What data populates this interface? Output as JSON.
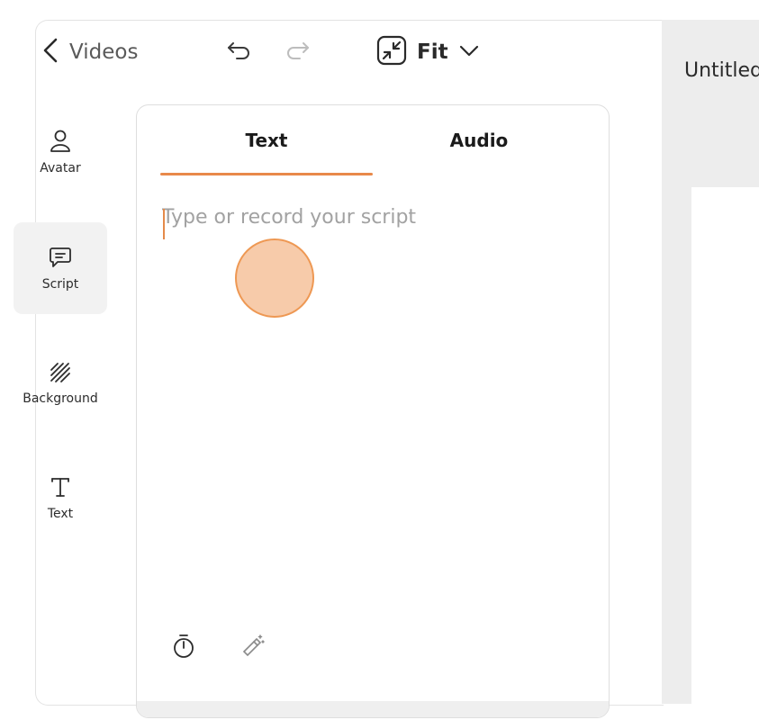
{
  "topbar": {
    "back_label": "Videos",
    "zoom_label": "Fit"
  },
  "canvas": {
    "title": "Untitled"
  },
  "sidebar": {
    "items": [
      {
        "label": "Avatar",
        "icon": "avatar-icon"
      },
      {
        "label": "Script",
        "icon": "script-icon",
        "active": true
      },
      {
        "label": "Background",
        "icon": "background-icon"
      },
      {
        "label": "Text",
        "icon": "text-icon"
      }
    ]
  },
  "script_panel": {
    "tabs": [
      {
        "label": "Text",
        "active": true
      },
      {
        "label": "Audio"
      }
    ],
    "placeholder": "Type or record your script",
    "value": ""
  },
  "colors": {
    "accent": "#e8894a",
    "active_bg": "#f2f2f2",
    "canvas_bg": "#ededed"
  }
}
